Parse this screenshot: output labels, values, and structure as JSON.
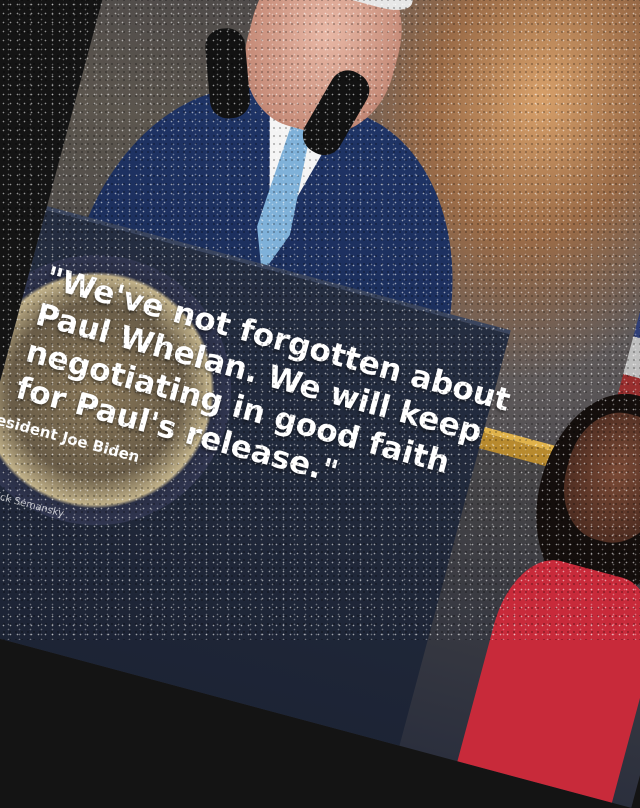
{
  "caption": {
    "quote": "\"We've not forgotten about\nPaul Whelan. We will keep\nnegotiating in good faith\nfor Paul's release.\"",
    "attribution": "President Joe Biden",
    "credit": "oto/Patrick Semansky"
  },
  "colors": {
    "suit": "#1f3466",
    "tie": "#7fb1d9",
    "dress": "#c82a3a",
    "frame_gold": "#b88a2e"
  }
}
